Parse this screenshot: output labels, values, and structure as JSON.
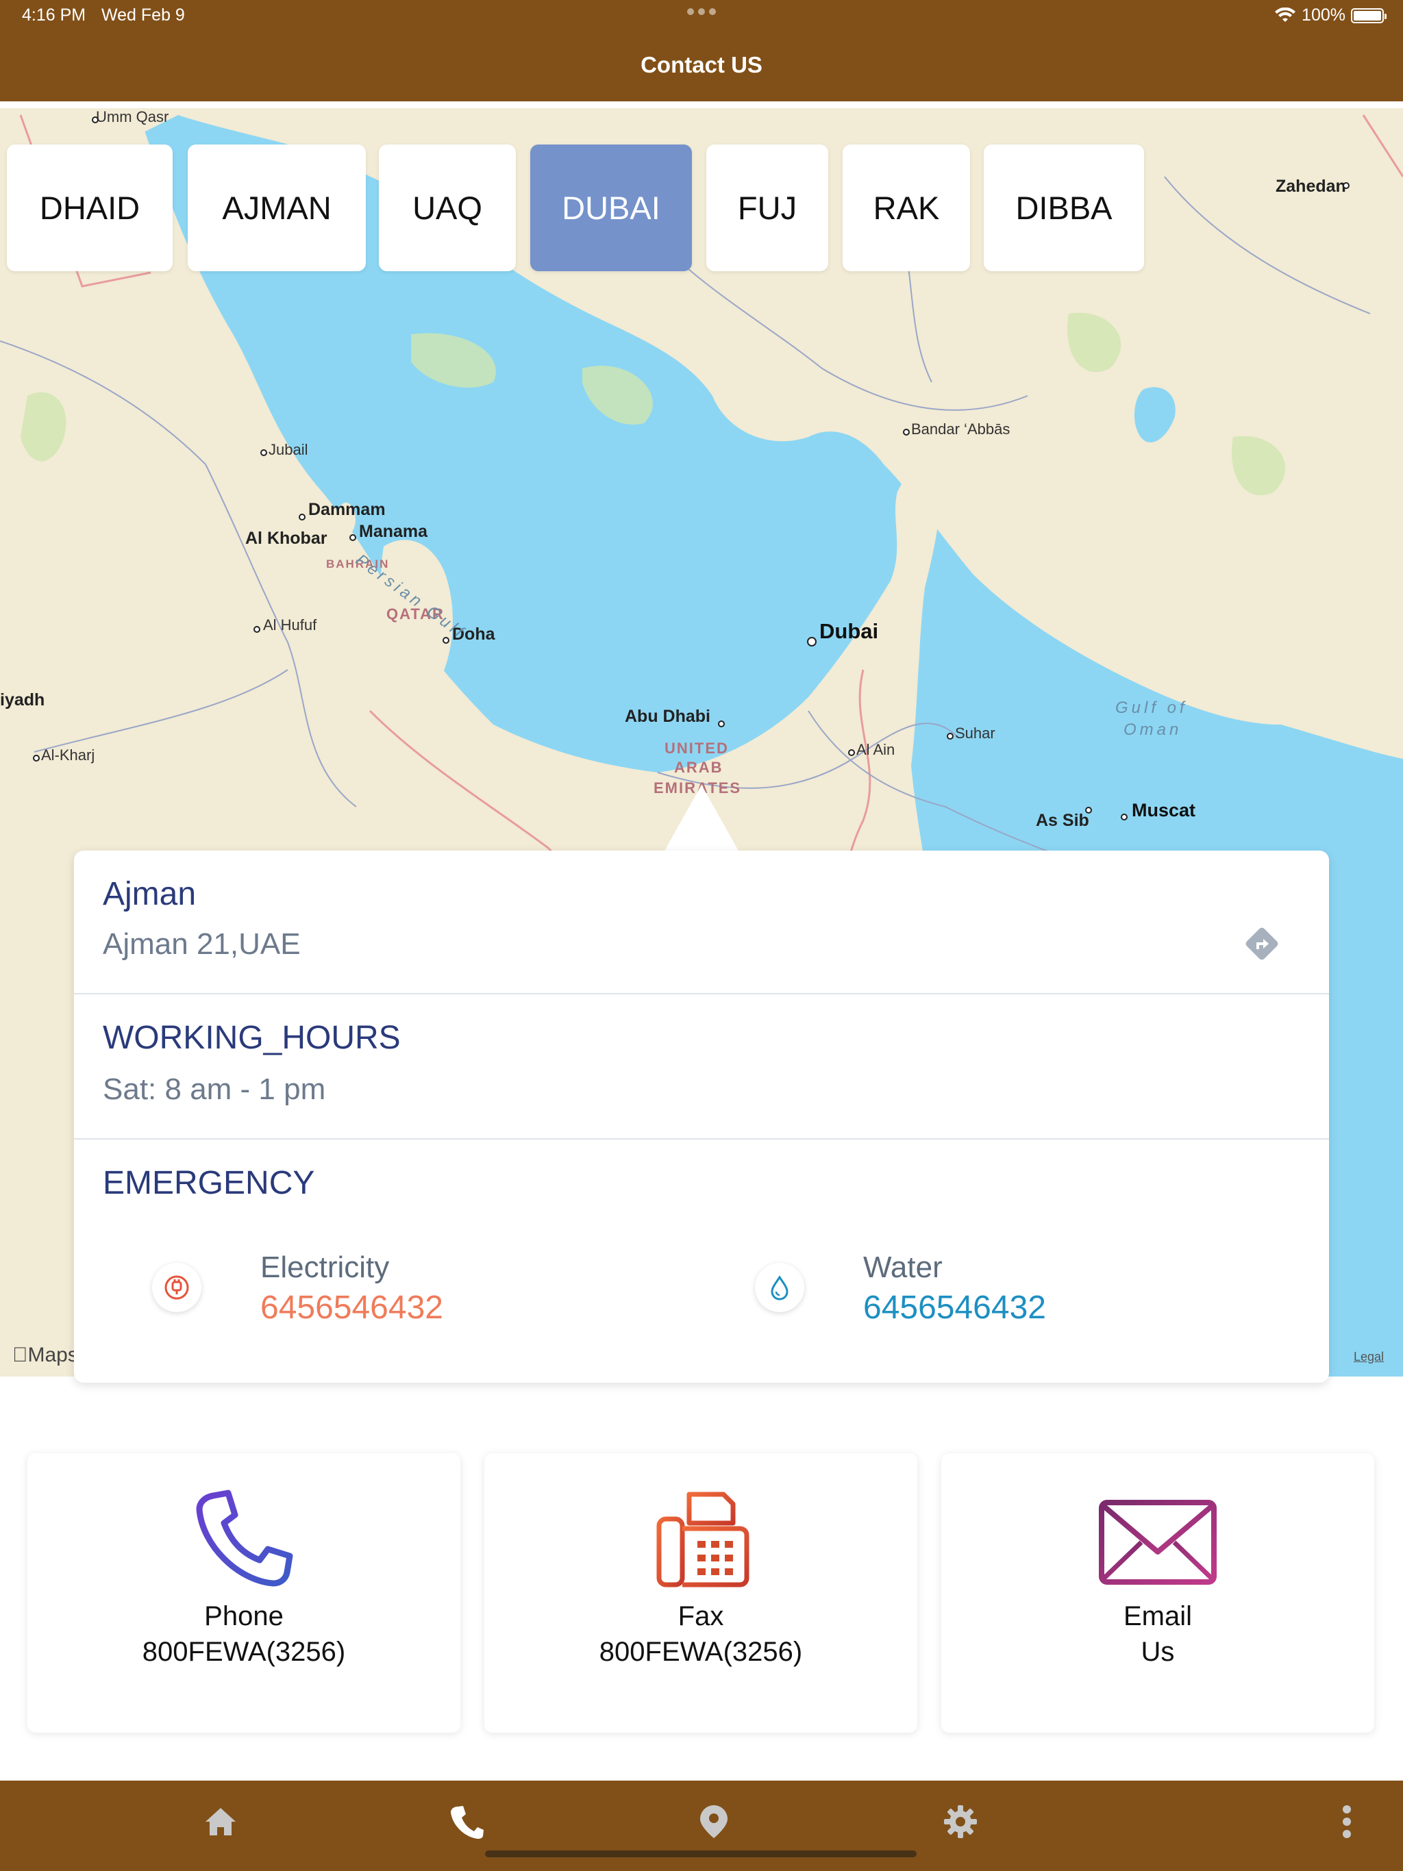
{
  "status_bar": {
    "time": "4:16 PM",
    "date": "Wed Feb 9",
    "battery": "100%"
  },
  "header": {
    "title": "Contact US"
  },
  "colors": {
    "brand": "#815018",
    "tab_active": "#7592cb",
    "title_blue": "#2a3a7a",
    "electricity": "#ef7b5a",
    "water": "#1d8fc1",
    "phone_icon": "#4b4bc6",
    "fax_icon": "#d24a2a",
    "email_icon": "#a02c78"
  },
  "tabs": [
    {
      "label": "DHAID",
      "active": false
    },
    {
      "label": "AJMAN",
      "active": false
    },
    {
      "label": "UAQ",
      "active": false
    },
    {
      "label": "DUBAI",
      "active": true
    },
    {
      "label": "FUJ",
      "active": false
    },
    {
      "label": "RAK",
      "active": false
    },
    {
      "label": "DIBBA",
      "active": false
    }
  ],
  "map": {
    "labels": {
      "umm_qasr": "Umm Qasr",
      "zahedan": "Zahedan",
      "bandar_abbas": "Bandar ‘Abbās",
      "jubail": "Jubail",
      "dammam": "Dammam",
      "al_khobar": "Al Khobar",
      "manama": "Manama",
      "bahrain": "BAHRAIN",
      "qatar": "QATAR",
      "doha": "Doha",
      "al_hufuf": "Al Hufuf",
      "riyadh": "iyadh",
      "al_kharj": "Al-Kharj",
      "dubai": "Dubai",
      "abu_dhabi": "Abu Dhabi",
      "uae_1": "UNITED",
      "uae_2": "ARAB",
      "uae_3": "EMIRATES",
      "al_ain": "Al Ain",
      "suhar": "Suhar",
      "as_sib": "As Sib",
      "muscat": "Muscat",
      "gulf_of_oman_1": "Gulf of",
      "gulf_of_oman_2": "Oman",
      "persian_gulf": "Persian Gulf"
    },
    "attribution": "Maps",
    "legal": "Legal"
  },
  "info_card": {
    "location_name": "Ajman",
    "address": "Ajman 21,UAE",
    "hours_title": "WORKING_HOURS",
    "hours_value": "Sat: 8 am - 1 pm",
    "emergency_title": "EMERGENCY",
    "electricity_label": "Electricity",
    "electricity_number": "6456546432",
    "water_label": "Water",
    "water_number": "6456546432"
  },
  "contacts": {
    "phone_label": "Phone",
    "phone_value": "800FEWA(3256)",
    "fax_label": "Fax",
    "fax_value": "800FEWA(3256)",
    "email_label": "Email",
    "email_value": "Us"
  },
  "bottom_nav": [
    {
      "icon": "home-icon",
      "active": false
    },
    {
      "icon": "phone-icon",
      "active": true
    },
    {
      "icon": "location-pin-icon",
      "active": false
    },
    {
      "icon": "gear-icon",
      "active": false
    },
    {
      "icon": "more-vertical-icon",
      "active": false
    }
  ]
}
